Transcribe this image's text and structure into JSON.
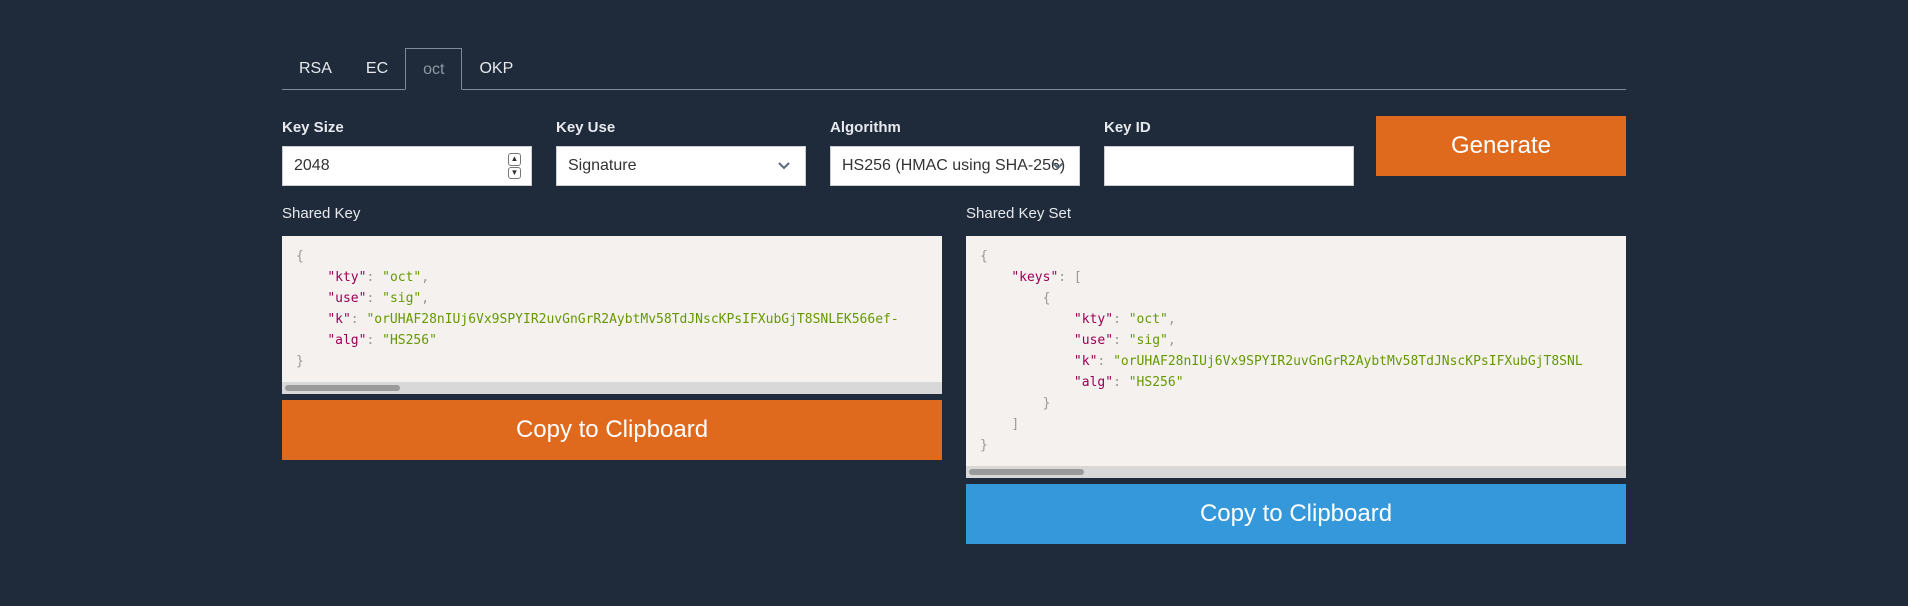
{
  "tabs": [
    {
      "label": "RSA",
      "active": false
    },
    {
      "label": "EC",
      "active": false
    },
    {
      "label": "oct",
      "active": true
    },
    {
      "label": "OKP",
      "active": false
    }
  ],
  "form": {
    "key_size": {
      "label": "Key Size",
      "value": "2048"
    },
    "key_use": {
      "label": "Key Use",
      "value": "Signature"
    },
    "algorithm": {
      "label": "Algorithm",
      "value": "HS256 (HMAC using SHA-256)"
    },
    "key_id": {
      "label": "Key ID",
      "value": ""
    },
    "generate_label": "Generate"
  },
  "shared_key": {
    "title": "Shared Key",
    "kty": "oct",
    "use": "sig",
    "k": "orUHAF28nIUj6Vx9SPYIR2uvGnGrR2AybtMv58TdJNscKPsIFXubGjT8SNLEK566ef-",
    "alg": "HS256",
    "copy_label": "Copy to Clipboard"
  },
  "shared_key_set": {
    "title": "Shared Key Set",
    "keys_label": "keys",
    "kty": "oct",
    "use": "sig",
    "k": "orUHAF28nIUj6Vx9SPYIR2uvGnGrR2AybtMv58TdJNscKPsIFXubGjT8SNL",
    "alg": "HS256",
    "copy_label": "Copy to Clipboard"
  },
  "colors": {
    "background": "#1f2b3a",
    "accent_orange": "#df6a1e",
    "accent_blue": "#3498db",
    "code_bg": "#f4f1ee"
  }
}
